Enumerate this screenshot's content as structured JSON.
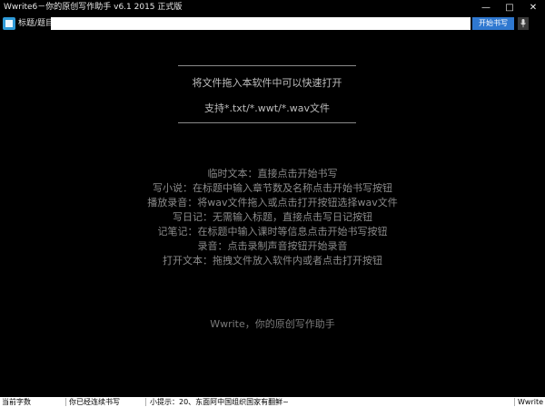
{
  "window": {
    "title": "Wwrite6－你的原创写作助手  v6.1 2015 正式版",
    "controls": {
      "minimize": "—",
      "maximize": "□",
      "close": "✕"
    }
  },
  "toolbar": {
    "title_label": "标题/题目：",
    "title_input_value": "",
    "start_button_label": "开始书写",
    "mic_icon": "microphone-icon"
  },
  "drop_zone": {
    "line1": "将文件拖入本软件中可以快速打开",
    "line2": "支持*.txt/*.wwt/*.wav文件"
  },
  "help": {
    "items": [
      "临时文本：直接点击开始书写",
      "写小说：在标题中输入章节数及名称点击开始书写按钮",
      "播放录音：将wav文件拖入或点击打开按钮选择wav文件",
      "写日记：无需输入标题，直接点击写日记按钮",
      "记笔记：在标题中输入课时等信息点击开始书写按钮",
      "录音：点击录制声音按钮开始录音",
      "打开文本：拖拽文件放入软件内或者点击打开按钮"
    ]
  },
  "slogan": "Wwrite，你的原创写作助手",
  "statusbar": {
    "word_count": "当前字数",
    "continuous": "你已经连续书写",
    "tip": "小提示：20、东面阿中国组织国家有翻鲜~",
    "brand": "Wwrite"
  },
  "colors": {
    "background": "#000000",
    "accent": "#2f78d0",
    "app_icon": "#2e9ad8"
  }
}
